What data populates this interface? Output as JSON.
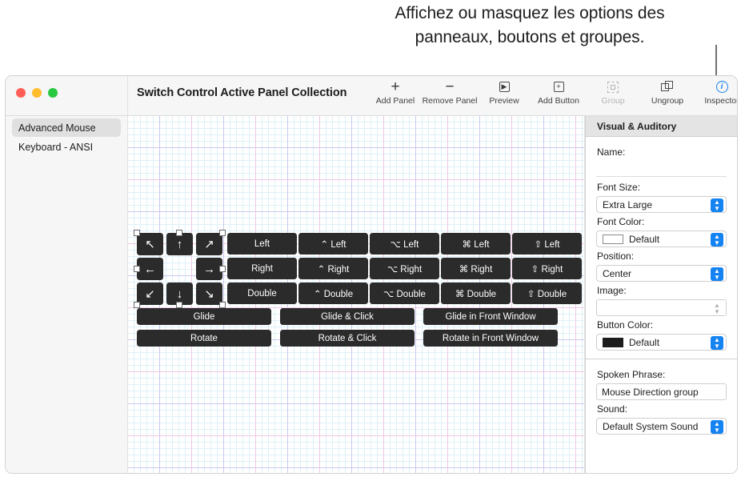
{
  "caption": {
    "line1": "Affichez ou masquez les options des",
    "line2": "panneaux, boutons et groupes."
  },
  "window": {
    "doc_title": "Switch Control Active Panel Collection"
  },
  "toolbar": {
    "items": [
      {
        "label": "Add Panel",
        "icon": "plus-icon",
        "enabled": true
      },
      {
        "label": "Remove Panel",
        "icon": "minus-icon",
        "enabled": true
      },
      {
        "label": "Preview",
        "icon": "play-box-icon",
        "enabled": true
      },
      {
        "label": "Add Button",
        "icon": "plus-box-icon",
        "enabled": true
      },
      {
        "label": "Group",
        "icon": "group-icon",
        "enabled": false
      },
      {
        "label": "Ungroup",
        "icon": "ungroup-icon",
        "enabled": true
      },
      {
        "label": "Inspector",
        "icon": "info-icon",
        "enabled": true
      }
    ]
  },
  "sidebar": {
    "items": [
      {
        "label": "Advanced Mouse",
        "selected": true
      },
      {
        "label": "Keyboard - ANSI",
        "selected": false
      }
    ]
  },
  "canvas": {
    "arrow_buttons": [
      {
        "glyph": "↖",
        "name": "arrow-up-left"
      },
      {
        "glyph": "↑",
        "name": "arrow-up"
      },
      {
        "glyph": "↗",
        "name": "arrow-up-right"
      },
      {
        "glyph": "←",
        "name": "arrow-left"
      },
      {
        "glyph": "→",
        "name": "arrow-right"
      },
      {
        "glyph": "↙",
        "name": "arrow-down-left"
      },
      {
        "glyph": "↓",
        "name": "arrow-down"
      },
      {
        "glyph": "↘",
        "name": "arrow-down-right"
      }
    ],
    "click_grid": [
      [
        "Left",
        "⌃ Left",
        "⌥ Left",
        "⌘ Left",
        "⇧ Left"
      ],
      [
        "Right",
        "⌃ Right",
        "⌥ Right",
        "⌘ Right",
        "⇧ Right"
      ],
      [
        "Double",
        "⌃ Double",
        "⌥ Double",
        "⌘ Double",
        "⇧ Double"
      ]
    ],
    "wide_rows": [
      [
        "Glide",
        "Glide & Click",
        "Glide in Front Window"
      ],
      [
        "Rotate",
        "Rotate & Click",
        "Rotate in Front Window"
      ]
    ]
  },
  "inspector": {
    "header": "Visual & Auditory",
    "name_label": "Name:",
    "name_value": "",
    "font_size_label": "Font Size:",
    "font_size_value": "Extra Large",
    "font_color_label": "Font Color:",
    "font_color_value": "Default",
    "font_color_swatch": "#ffffff",
    "position_label": "Position:",
    "position_value": "Center",
    "image_label": "Image:",
    "image_value": "",
    "button_color_label": "Button Color:",
    "button_color_value": "Default",
    "button_color_swatch": "#1c1c1c",
    "spoken_phrase_label": "Spoken Phrase:",
    "spoken_phrase_value": "Mouse Direction group",
    "sound_label": "Sound:",
    "sound_value": "Default System Sound"
  },
  "colors": {
    "accent": "#1583f2",
    "button_fill": "#2b2b2b",
    "grid_fine": "#ddf1f8",
    "grid_mid": "#c9c9ef",
    "grid_major": "#f0c8e4"
  }
}
